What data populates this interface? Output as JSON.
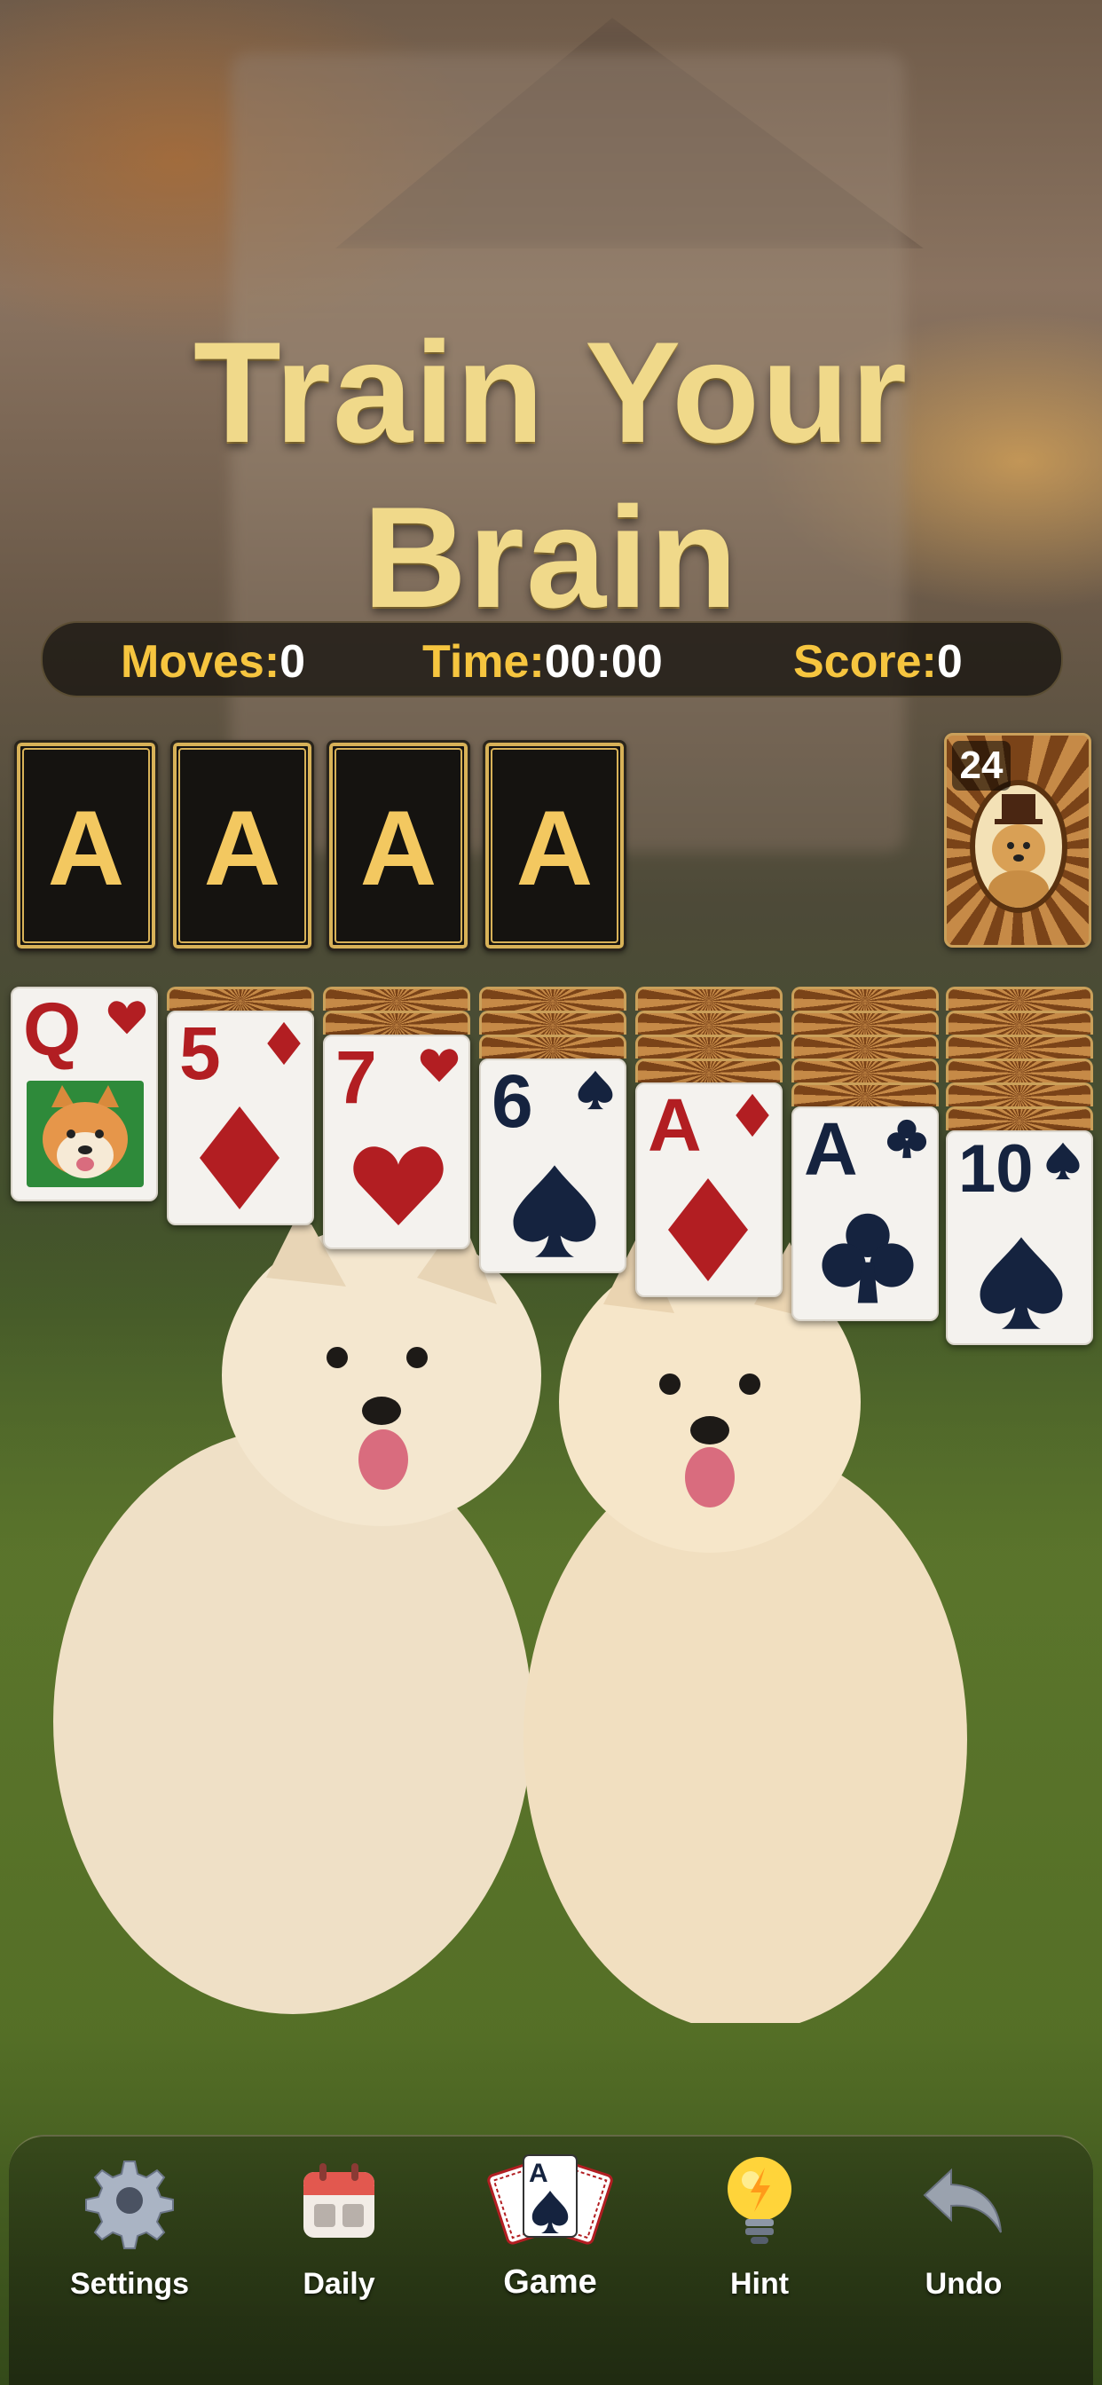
{
  "headline": "Train Your Brain",
  "stats": {
    "moves_label": "Moves:",
    "moves_value": "0",
    "time_label": "Time:",
    "time_value": "00:00",
    "score_label": "Score:",
    "score_value": "0"
  },
  "foundations": [
    "A",
    "A",
    "A",
    "A"
  ],
  "stock": {
    "count": "24",
    "art_icon": "golden-retriever-portrait-icon"
  },
  "tableau": [
    {
      "hidden": 0,
      "rank": "Q",
      "suit": "hearts",
      "face_art": "shiba-inu-portrait"
    },
    {
      "hidden": 1,
      "rank": "5",
      "suit": "diamonds"
    },
    {
      "hidden": 2,
      "rank": "7",
      "suit": "hearts"
    },
    {
      "hidden": 3,
      "rank": "6",
      "suit": "spades"
    },
    {
      "hidden": 4,
      "rank": "A",
      "suit": "diamonds"
    },
    {
      "hidden": 5,
      "rank": "A",
      "suit": "clubs"
    },
    {
      "hidden": 6,
      "rank": "10",
      "suit": "spades"
    }
  ],
  "colors": {
    "accent_gold": "#f6c53f",
    "red_suit": "#b21e22",
    "black_suit": "#15233f"
  },
  "toolbar": {
    "settings": "Settings",
    "daily": "Daily",
    "game": "Game",
    "hint": "Hint",
    "undo": "Undo"
  }
}
